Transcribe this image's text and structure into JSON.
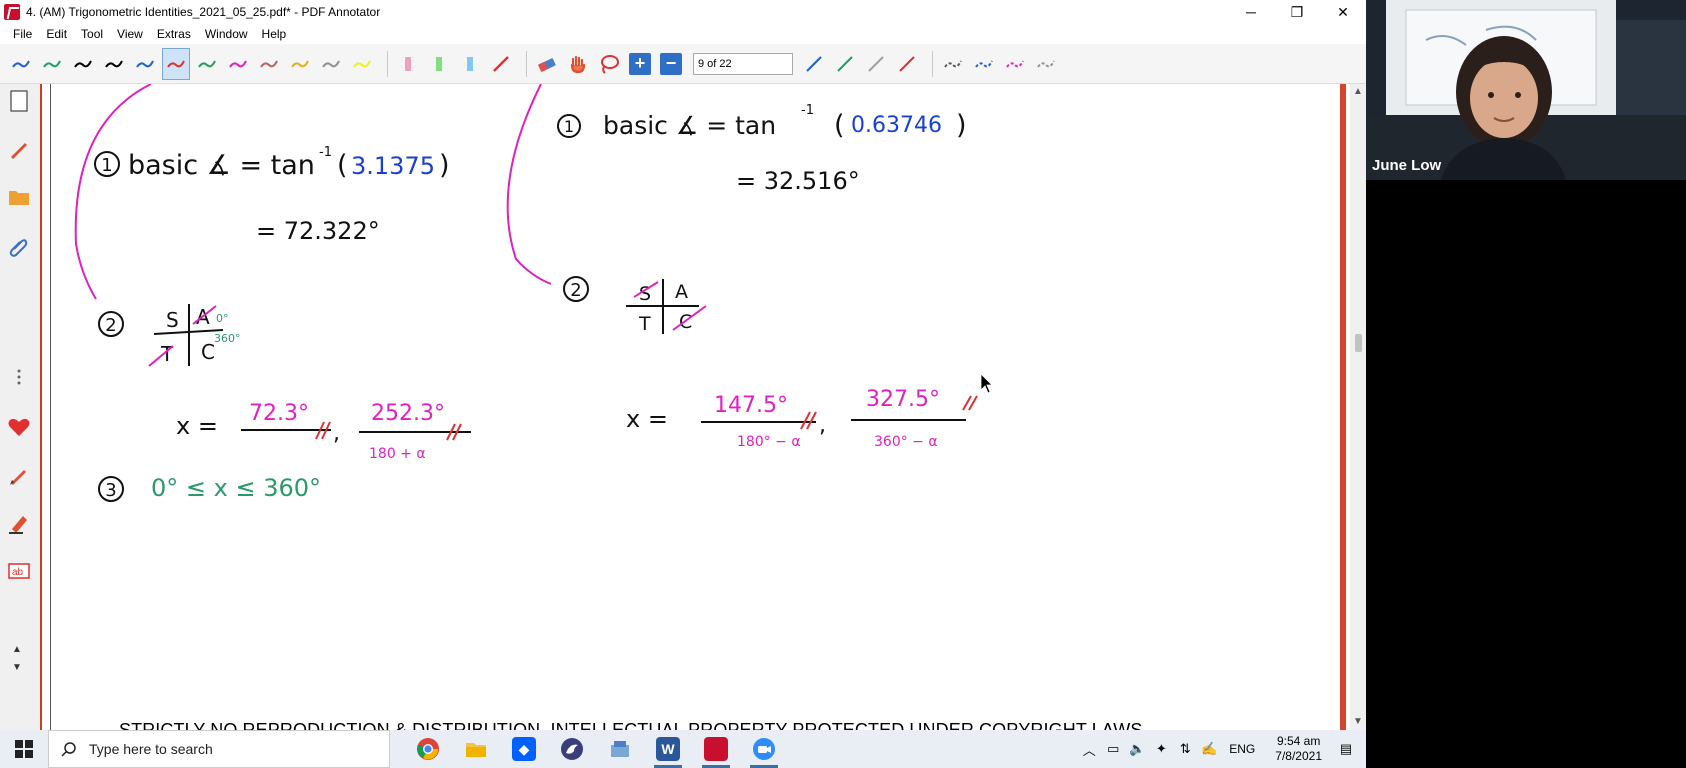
{
  "window": {
    "title": "4. (AM) Trigonometric Identities_2021_05_25.pdf* - PDF Annotator",
    "minimize_glyph": "─",
    "maximize_glyph": "❐",
    "close_glyph": "✕"
  },
  "menu": [
    "File",
    "Edit",
    "Tool",
    "View",
    "Extras",
    "Window",
    "Help"
  ],
  "menu_underline": [
    "F",
    "E",
    "T",
    "V",
    "x",
    "W",
    "H"
  ],
  "toolbar": {
    "page_value": "9 of 22",
    "plus_label": "+",
    "minus_label": "−",
    "pen_colors": [
      "#2060d0",
      "#20a060",
      "#000000",
      "#000000",
      "#2060d0",
      "#e03030",
      "#20a060",
      "#e020c0",
      "#c06060",
      "#e0b020",
      "#909090",
      "#f0f020"
    ],
    "highlighter_colors": [
      "#f0a0c0",
      "#80e080",
      "#80c8f0"
    ],
    "line_colors": [
      "#2060d0",
      "#20a060",
      "#a0a0a0",
      "#e03030"
    ],
    "dash_colors": [
      "#555555",
      "#2060d0",
      "#e020c0",
      "#909090"
    ]
  },
  "document": {
    "copyright": "STRICTLY NO REPRODUCTION & DISTRIBUTION. INTELLECTUAL PROPERTY PROTECTED UNDER COPYRIGHT LAWS",
    "left": {
      "step1_num": "1",
      "step1_text": "basic ∡ = tan",
      "step1_sup": "-1",
      "step1_open": "(",
      "step1_value": "3.1375",
      "step1_close": ")",
      "step1_result": "= 72.322°",
      "step2_num": "2",
      "quad_s": "S",
      "quad_a": "A",
      "quad_t": "T",
      "quad_c": "C",
      "quad_0": "0°",
      "quad_360": "360°",
      "x_eq": "x =",
      "sol1": "72.3°",
      "sol2": "252.3°",
      "sol2_note": "180 + α",
      "comma": ",",
      "step3_num": "3",
      "range": "0° ≤ x ≤ 360°"
    },
    "right": {
      "step1_num": "1",
      "step1_text": "basic ∡ = tan",
      "step1_sup": "-1",
      "step1_open": "(",
      "step1_value": "0.63746",
      "step1_close": ")",
      "step1_result": "= 32.516°",
      "step2_num": "2",
      "quad_s": "S",
      "quad_a": "A",
      "quad_t": "T",
      "quad_c": "C",
      "x_eq": "x =",
      "sol1": "147.5°",
      "sol1_note": "180° − α",
      "sol2": "327.5°",
      "sol2_note": "360° − α",
      "comma": ","
    }
  },
  "taskbar": {
    "search_placeholder": "Type here to search",
    "lang": "ENG",
    "time": "9:54 am",
    "date": "7/8/2021",
    "apps": [
      "chrome",
      "file-explorer",
      "dropbox",
      "firefox",
      "onedrive-folder",
      "word",
      "pdf-annotator",
      "zoom"
    ]
  },
  "webcam": {
    "name": "June Low"
  },
  "colors": {
    "magenta": "#e020c0",
    "blue": "#1a3fd6",
    "green": "#2a9a6a",
    "black": "#111111",
    "red": "#e03030"
  }
}
